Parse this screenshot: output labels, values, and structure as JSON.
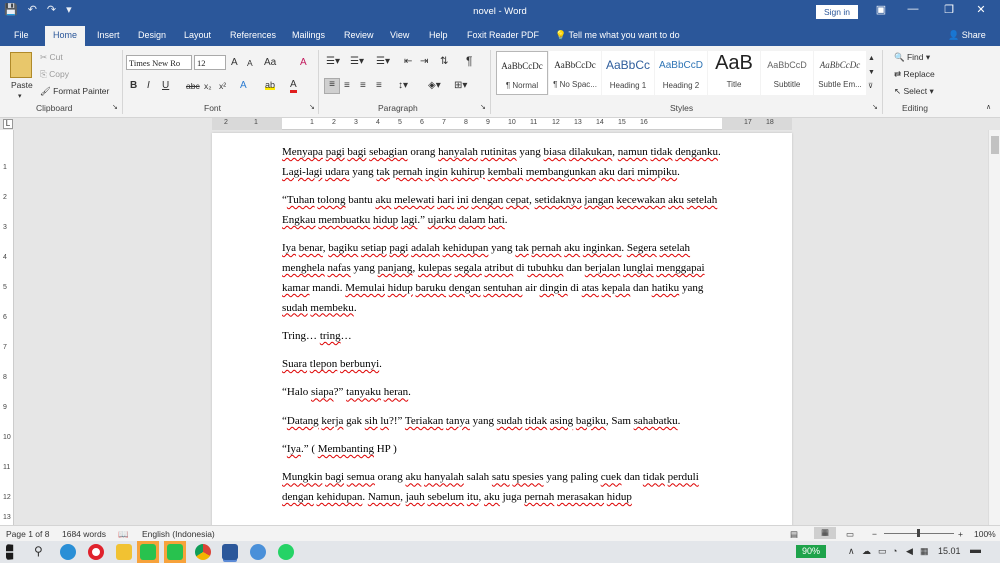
{
  "titlebar": {
    "title": "novel - Word",
    "sign_in": "Sign in",
    "save_icon": "💾",
    "undo_icon": "↶",
    "redo_icon": "↷",
    "customize_icon": "▾",
    "ribbon_display_icon": "▣",
    "minimize_icon": "—",
    "restore_icon": "❐",
    "close_icon": "✕"
  },
  "tabs": [
    "File",
    "Home",
    "Insert",
    "Design",
    "Layout",
    "References",
    "Mailings",
    "Review",
    "View",
    "Help",
    "Foxit Reader PDF"
  ],
  "tell_me": "Tell me what you want to do",
  "share": "Share",
  "clipboard": {
    "paste": "Paste",
    "cut": "Cut",
    "copy": "Copy",
    "format_painter": "Format Painter",
    "label": "Clipboard"
  },
  "font": {
    "name": "Times New Ro",
    "size": "12",
    "grow": "A",
    "shrink": "A",
    "case": "Aa",
    "clear": "A",
    "bold": "B",
    "italic": "I",
    "underline": "U",
    "strike": "abc",
    "subscript": "x₂",
    "superscript": "x²",
    "effects": "A",
    "highlight": "ab",
    "color": "A",
    "label": "Font"
  },
  "paragraph": {
    "pilcrow": "¶",
    "label": "Paragraph"
  },
  "styles": {
    "items": [
      {
        "preview": "AaBbCcDc",
        "name": "¶ Normal"
      },
      {
        "preview": "AaBbCcDc",
        "name": "¶ No Spac..."
      },
      {
        "preview": "AaBbCc",
        "name": "Heading 1"
      },
      {
        "preview": "AaBbCcD",
        "name": "Heading 2"
      },
      {
        "preview": "AaB",
        "name": "Title"
      },
      {
        "preview": "AaBbCcD",
        "name": "Subtitle"
      },
      {
        "preview": "AaBbCcDc",
        "name": "Subtle Em..."
      }
    ],
    "label": "Styles"
  },
  "editing": {
    "find": "Find",
    "replace": "Replace",
    "select": "Select",
    "label": "Editing"
  },
  "ruler": [
    "2",
    "1",
    "1",
    "2",
    "3",
    "4",
    "5",
    "6",
    "7",
    "8",
    "9",
    "10",
    "11",
    "12",
    "13",
    "14",
    "15",
    "16",
    "17",
    "18"
  ],
  "vruler": [
    "1",
    "2",
    "3",
    "4",
    "5",
    "6",
    "7",
    "8",
    "9",
    "10",
    "11",
    "12",
    "13"
  ],
  "document": {
    "paragraphs": [
      [
        {
          "t": "Menyapa",
          "e": true
        },
        {
          "t": " "
        },
        {
          "t": "pagi",
          "e": true
        },
        {
          "t": " "
        },
        {
          "t": "bagi",
          "e": true
        },
        {
          "t": " "
        },
        {
          "t": "sebagian",
          "e": true
        },
        {
          "t": " orang "
        },
        {
          "t": "hanyalah",
          "e": true
        },
        {
          "t": " "
        },
        {
          "t": "rutinitas",
          "e": true
        },
        {
          "t": " yang "
        },
        {
          "t": "biasa",
          "e": true
        },
        {
          "t": " "
        },
        {
          "t": "dilakukan",
          "e": true
        },
        {
          "t": ", "
        },
        {
          "t": "namun",
          "e": true
        },
        {
          "t": " "
        },
        {
          "t": "tidak",
          "e": true
        },
        {
          "t": " "
        },
        {
          "t": "denganku",
          "e": true
        },
        {
          "t": ". "
        },
        {
          "t": "Lagi-lagi",
          "e": true
        },
        {
          "t": " "
        },
        {
          "t": "udara",
          "e": true
        },
        {
          "t": " yang "
        },
        {
          "t": "tak",
          "e": true
        },
        {
          "t": " "
        },
        {
          "t": "pernah",
          "e": true
        },
        {
          "t": " "
        },
        {
          "t": "ingin",
          "e": true
        },
        {
          "t": " "
        },
        {
          "t": "kuhirup",
          "e": true
        },
        {
          "t": " "
        },
        {
          "t": "kembali",
          "e": true
        },
        {
          "t": " "
        },
        {
          "t": "membangunkan",
          "e": true
        },
        {
          "t": " "
        },
        {
          "t": "aku",
          "e": true
        },
        {
          "t": " "
        },
        {
          "t": "dari",
          "e": true
        },
        {
          "t": " "
        },
        {
          "t": "mimpiku",
          "e": true
        },
        {
          "t": "."
        }
      ],
      [
        {
          "t": "“"
        },
        {
          "t": "Tuhan",
          "e": true
        },
        {
          "t": " "
        },
        {
          "t": "tolong",
          "e": true
        },
        {
          "t": " bantu "
        },
        {
          "t": "aku",
          "e": true
        },
        {
          "t": " "
        },
        {
          "t": "melewati",
          "e": true
        },
        {
          "t": " "
        },
        {
          "t": "hari",
          "e": true
        },
        {
          "t": " "
        },
        {
          "t": "ini",
          "e": true
        },
        {
          "t": " "
        },
        {
          "t": "dengan",
          "e": true
        },
        {
          "t": " "
        },
        {
          "t": "cepat",
          "e": true
        },
        {
          "t": ", "
        },
        {
          "t": "setidaknya",
          "e": true
        },
        {
          "t": " "
        },
        {
          "t": "jangan",
          "e": true
        },
        {
          "t": " "
        },
        {
          "t": "kecewakan",
          "e": true
        },
        {
          "t": " "
        },
        {
          "t": "aku",
          "e": true
        },
        {
          "t": " "
        },
        {
          "t": "setelah",
          "e": true
        },
        {
          "t": " "
        },
        {
          "t": "Engkau",
          "e": true
        },
        {
          "t": " "
        },
        {
          "t": "membuatku",
          "e": true
        },
        {
          "t": " "
        },
        {
          "t": "hidup",
          "e": true
        },
        {
          "t": " "
        },
        {
          "t": "lagi",
          "e": true
        },
        {
          "t": ".” "
        },
        {
          "t": "ujarku",
          "e": true
        },
        {
          "t": " "
        },
        {
          "t": "dalam",
          "e": true
        },
        {
          "t": " "
        },
        {
          "t": "hati",
          "e": true
        },
        {
          "t": "."
        }
      ],
      [
        {
          "t": "Iya",
          "e": true
        },
        {
          "t": " "
        },
        {
          "t": "benar",
          "e": true
        },
        {
          "t": ", "
        },
        {
          "t": "bagiku",
          "e": true
        },
        {
          "t": " "
        },
        {
          "t": "setiap",
          "e": true
        },
        {
          "t": " "
        },
        {
          "t": "pagi",
          "e": true
        },
        {
          "t": " "
        },
        {
          "t": "adalah",
          "e": true
        },
        {
          "t": " "
        },
        {
          "t": "kehidupan",
          "e": true
        },
        {
          "t": "  yang "
        },
        {
          "t": "tak",
          "e": true
        },
        {
          "t": " "
        },
        {
          "t": "pernah",
          "e": true
        },
        {
          "t": " "
        },
        {
          "t": "aku",
          "e": true
        },
        {
          "t": " "
        },
        {
          "t": "inginkan",
          "e": true
        },
        {
          "t": ". "
        },
        {
          "t": "Segera",
          "e": true
        },
        {
          "t": " "
        },
        {
          "t": "setelah",
          "e": true
        },
        {
          "t": " "
        },
        {
          "t": "menghela",
          "e": true
        },
        {
          "t": " "
        },
        {
          "t": "nafas",
          "e": true
        },
        {
          "t": " yang "
        },
        {
          "t": "panjang",
          "e": true
        },
        {
          "t": ", "
        },
        {
          "t": "kulepas",
          "e": true
        },
        {
          "t": " "
        },
        {
          "t": "segala",
          "e": true
        },
        {
          "t": " "
        },
        {
          "t": "atribut",
          "e": true
        },
        {
          "t": " di "
        },
        {
          "t": "tubuhku",
          "e": true
        },
        {
          "t": " dan "
        },
        {
          "t": "berjalan",
          "e": true
        },
        {
          "t": " "
        },
        {
          "t": "lunglai",
          "e": true
        },
        {
          "t": " "
        },
        {
          "t": "menggapai",
          "e": true
        },
        {
          "t": " "
        },
        {
          "t": "kamar",
          "e": true
        },
        {
          "t": " mandi. "
        },
        {
          "t": "Memulai",
          "e": true
        },
        {
          "t": " "
        },
        {
          "t": "hidup",
          "e": true
        },
        {
          "t": " "
        },
        {
          "t": "baruku",
          "e": true
        },
        {
          "t": " "
        },
        {
          "t": "dengan",
          "e": true
        },
        {
          "t": " "
        },
        {
          "t": "sentuhan",
          "e": true
        },
        {
          "t": " air "
        },
        {
          "t": "dingin",
          "e": true
        },
        {
          "t": " di "
        },
        {
          "t": "atas",
          "e": true
        },
        {
          "t": " "
        },
        {
          "t": "kepala",
          "e": true
        },
        {
          "t": " dan "
        },
        {
          "t": "hatiku",
          "e": true
        },
        {
          "t": " yang "
        },
        {
          "t": "sudah",
          "e": true
        },
        {
          "t": " "
        },
        {
          "t": "membeku",
          "e": true
        },
        {
          "t": "."
        }
      ],
      [
        {
          "t": "Tring… "
        },
        {
          "t": "tring",
          "e": true
        },
        {
          "t": "…"
        }
      ],
      [
        {
          "t": "Suara",
          "e": true
        },
        {
          "t": " "
        },
        {
          "t": "tlepon",
          "e": true
        },
        {
          "t": " "
        },
        {
          "t": "berbunyi",
          "e": true
        },
        {
          "t": "."
        }
      ],
      [
        {
          "t": "“Halo "
        },
        {
          "t": "siapa",
          "e": true
        },
        {
          "t": "?” "
        },
        {
          "t": "tanyaku",
          "e": true
        },
        {
          "t": " "
        },
        {
          "t": "heran",
          "e": true
        },
        {
          "t": "."
        }
      ],
      [
        {
          "t": "“"
        },
        {
          "t": "Datang",
          "e": true
        },
        {
          "t": " "
        },
        {
          "t": "kerja",
          "e": true
        },
        {
          "t": " gak "
        },
        {
          "t": "sih",
          "e": true
        },
        {
          "t": " "
        },
        {
          "t": "lu",
          "e": true
        },
        {
          "t": "?!” "
        },
        {
          "t": "Teriakan",
          "e": true
        },
        {
          "t": " "
        },
        {
          "t": "tanya",
          "e": true
        },
        {
          "t": " yang "
        },
        {
          "t": "sudah",
          "e": true
        },
        {
          "t": " "
        },
        {
          "t": "tidak",
          "e": true
        },
        {
          "t": " "
        },
        {
          "t": "asing",
          "e": true
        },
        {
          "t": " "
        },
        {
          "t": "bagiku",
          "e": true
        },
        {
          "t": ", Sam "
        },
        {
          "t": "sahabatku",
          "e": true
        },
        {
          "t": "."
        }
      ],
      [
        {
          "t": "“"
        },
        {
          "t": "Iya",
          "e": true
        },
        {
          "t": ".” ( "
        },
        {
          "t": "Membanting",
          "e": true
        },
        {
          "t": " HP )"
        }
      ],
      [
        {
          "t": "Mungkin",
          "e": true
        },
        {
          "t": " "
        },
        {
          "t": "bagi",
          "e": true
        },
        {
          "t": " "
        },
        {
          "t": "semua",
          "e": true
        },
        {
          "t": " orang "
        },
        {
          "t": "aku",
          "e": true
        },
        {
          "t": " "
        },
        {
          "t": "hanyalah",
          "e": true
        },
        {
          "t": " salah "
        },
        {
          "t": "satu",
          "e": true
        },
        {
          "t": " "
        },
        {
          "t": "spesies",
          "e": true
        },
        {
          "t": " yang paling "
        },
        {
          "t": "cuek",
          "e": true
        },
        {
          "t": " dan "
        },
        {
          "t": "tidak",
          "e": true
        },
        {
          "t": " "
        },
        {
          "t": "perduli",
          "e": true
        },
        {
          "t": " "
        },
        {
          "t": "dengan",
          "e": true
        },
        {
          "t": " "
        },
        {
          "t": "kehidupan",
          "e": true
        },
        {
          "t": ". "
        },
        {
          "t": "Namun",
          "e": true
        },
        {
          "t": ",  "
        },
        {
          "t": "jauh",
          "e": true
        },
        {
          "t": " "
        },
        {
          "t": "sebelum",
          "e": true
        },
        {
          "t": " "
        },
        {
          "t": "itu",
          "e": true
        },
        {
          "t": ", "
        },
        {
          "t": "aku",
          "e": true
        },
        {
          "t": " juga "
        },
        {
          "t": "pernah",
          "e": true
        },
        {
          "t": " "
        },
        {
          "t": "merasakan",
          "e": true
        },
        {
          "t": " "
        },
        {
          "t": "hidup",
          "e": true
        }
      ]
    ]
  },
  "status": {
    "page": "Page 1 of 8",
    "words": "1684 words",
    "language": "English (Indonesia)",
    "zoom_minus": "−",
    "zoom_plus": "+",
    "zoom_level": "100%"
  },
  "taskbar": {
    "battery": "90%",
    "time": "15.01",
    "apps": [
      "windows",
      "search",
      "edge",
      "opera",
      "file-explorer",
      "line",
      "line",
      "chrome",
      "word",
      "chromium",
      "whatsapp"
    ]
  }
}
